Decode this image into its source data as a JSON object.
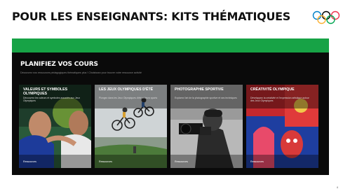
{
  "slide": {
    "title": "POUR LES ENSEIGNANTS: KITS THÉMATIQUES",
    "page_number": "8"
  },
  "colors": {
    "green_bar": "#17a346",
    "panel_bg": "#0a0a0a",
    "rings": [
      "#0081c8",
      "#000000",
      "#ee334e",
      "#fcb131",
      "#00a651"
    ]
  },
  "panel": {
    "title": "PLANIFIEZ VOS COURS",
    "subtitle": "Découvrez nos ressources pédagogiques thématiques plus ! Choisissez pour trouver votre ressource activité"
  },
  "cards": [
    {
      "title": "VALEURS ET SYMBOLES OLYMPIQUES",
      "description": "Découvrez les valeurs et symboles associés aux Jeux Olympiques",
      "link": "Ressources"
    },
    {
      "title": "LES JEUX OLYMPIQUES D'ÉTÉ",
      "description": "Plongez dans les Jeux Olympiques d'été et leurs sports",
      "link": "Ressources"
    },
    {
      "title": "PHOTOGRAPHIE SPORTIVE",
      "description": "Explorez l'art de la photographie sportive et ses techniques",
      "link": "Ressources"
    },
    {
      "title": "CRÉATIVITÉ OLYMPIQUE",
      "description": "Développez la créativité et l'expression artistique autour des Jeux Olympiques",
      "link": "Ressources"
    }
  ]
}
